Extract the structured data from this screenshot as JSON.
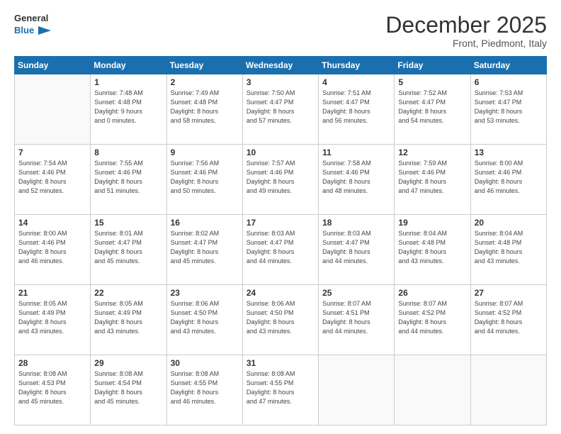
{
  "logo": {
    "line1": "General",
    "line2": "Blue"
  },
  "header": {
    "month": "December 2025",
    "location": "Front, Piedmont, Italy"
  },
  "weekdays": [
    "Sunday",
    "Monday",
    "Tuesday",
    "Wednesday",
    "Thursday",
    "Friday",
    "Saturday"
  ],
  "rows": [
    [
      {
        "day": "",
        "text": ""
      },
      {
        "day": "1",
        "text": "Sunrise: 7:48 AM\nSunset: 4:48 PM\nDaylight: 9 hours\nand 0 minutes."
      },
      {
        "day": "2",
        "text": "Sunrise: 7:49 AM\nSunset: 4:48 PM\nDaylight: 8 hours\nand 58 minutes."
      },
      {
        "day": "3",
        "text": "Sunrise: 7:50 AM\nSunset: 4:47 PM\nDaylight: 8 hours\nand 57 minutes."
      },
      {
        "day": "4",
        "text": "Sunrise: 7:51 AM\nSunset: 4:47 PM\nDaylight: 8 hours\nand 56 minutes."
      },
      {
        "day": "5",
        "text": "Sunrise: 7:52 AM\nSunset: 4:47 PM\nDaylight: 8 hours\nand 54 minutes."
      },
      {
        "day": "6",
        "text": "Sunrise: 7:53 AM\nSunset: 4:47 PM\nDaylight: 8 hours\nand 53 minutes."
      }
    ],
    [
      {
        "day": "7",
        "text": "Sunrise: 7:54 AM\nSunset: 4:46 PM\nDaylight: 8 hours\nand 52 minutes."
      },
      {
        "day": "8",
        "text": "Sunrise: 7:55 AM\nSunset: 4:46 PM\nDaylight: 8 hours\nand 51 minutes."
      },
      {
        "day": "9",
        "text": "Sunrise: 7:56 AM\nSunset: 4:46 PM\nDaylight: 8 hours\nand 50 minutes."
      },
      {
        "day": "10",
        "text": "Sunrise: 7:57 AM\nSunset: 4:46 PM\nDaylight: 8 hours\nand 49 minutes."
      },
      {
        "day": "11",
        "text": "Sunrise: 7:58 AM\nSunset: 4:46 PM\nDaylight: 8 hours\nand 48 minutes."
      },
      {
        "day": "12",
        "text": "Sunrise: 7:59 AM\nSunset: 4:46 PM\nDaylight: 8 hours\nand 47 minutes."
      },
      {
        "day": "13",
        "text": "Sunrise: 8:00 AM\nSunset: 4:46 PM\nDaylight: 8 hours\nand 46 minutes."
      }
    ],
    [
      {
        "day": "14",
        "text": "Sunrise: 8:00 AM\nSunset: 4:46 PM\nDaylight: 8 hours\nand 46 minutes."
      },
      {
        "day": "15",
        "text": "Sunrise: 8:01 AM\nSunset: 4:47 PM\nDaylight: 8 hours\nand 45 minutes."
      },
      {
        "day": "16",
        "text": "Sunrise: 8:02 AM\nSunset: 4:47 PM\nDaylight: 8 hours\nand 45 minutes."
      },
      {
        "day": "17",
        "text": "Sunrise: 8:03 AM\nSunset: 4:47 PM\nDaylight: 8 hours\nand 44 minutes."
      },
      {
        "day": "18",
        "text": "Sunrise: 8:03 AM\nSunset: 4:47 PM\nDaylight: 8 hours\nand 44 minutes."
      },
      {
        "day": "19",
        "text": "Sunrise: 8:04 AM\nSunset: 4:48 PM\nDaylight: 8 hours\nand 43 minutes."
      },
      {
        "day": "20",
        "text": "Sunrise: 8:04 AM\nSunset: 4:48 PM\nDaylight: 8 hours\nand 43 minutes."
      }
    ],
    [
      {
        "day": "21",
        "text": "Sunrise: 8:05 AM\nSunset: 4:49 PM\nDaylight: 8 hours\nand 43 minutes."
      },
      {
        "day": "22",
        "text": "Sunrise: 8:05 AM\nSunset: 4:49 PM\nDaylight: 8 hours\nand 43 minutes."
      },
      {
        "day": "23",
        "text": "Sunrise: 8:06 AM\nSunset: 4:50 PM\nDaylight: 8 hours\nand 43 minutes."
      },
      {
        "day": "24",
        "text": "Sunrise: 8:06 AM\nSunset: 4:50 PM\nDaylight: 8 hours\nand 43 minutes."
      },
      {
        "day": "25",
        "text": "Sunrise: 8:07 AM\nSunset: 4:51 PM\nDaylight: 8 hours\nand 44 minutes."
      },
      {
        "day": "26",
        "text": "Sunrise: 8:07 AM\nSunset: 4:52 PM\nDaylight: 8 hours\nand 44 minutes."
      },
      {
        "day": "27",
        "text": "Sunrise: 8:07 AM\nSunset: 4:52 PM\nDaylight: 8 hours\nand 44 minutes."
      }
    ],
    [
      {
        "day": "28",
        "text": "Sunrise: 8:08 AM\nSunset: 4:53 PM\nDaylight: 8 hours\nand 45 minutes."
      },
      {
        "day": "29",
        "text": "Sunrise: 8:08 AM\nSunset: 4:54 PM\nDaylight: 8 hours\nand 45 minutes."
      },
      {
        "day": "30",
        "text": "Sunrise: 8:08 AM\nSunset: 4:55 PM\nDaylight: 8 hours\nand 46 minutes."
      },
      {
        "day": "31",
        "text": "Sunrise: 8:08 AM\nSunset: 4:55 PM\nDaylight: 8 hours\nand 47 minutes."
      },
      {
        "day": "",
        "text": ""
      },
      {
        "day": "",
        "text": ""
      },
      {
        "day": "",
        "text": ""
      }
    ]
  ]
}
